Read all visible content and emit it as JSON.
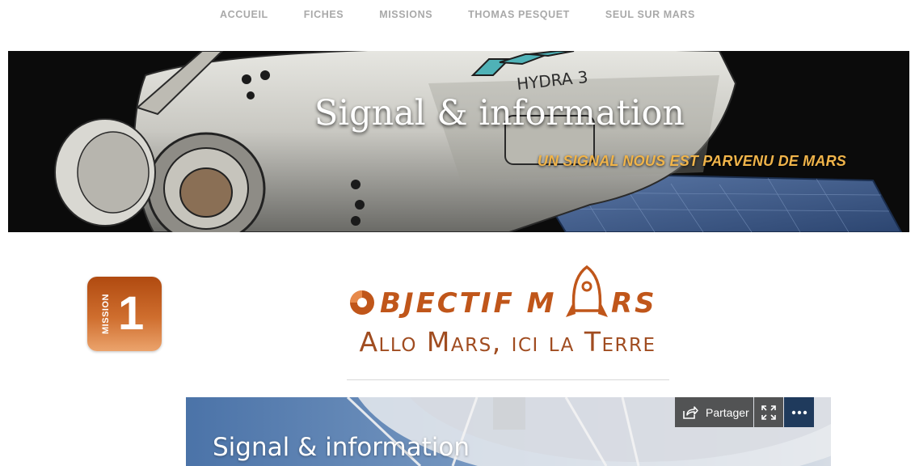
{
  "nav": {
    "items": [
      "ACCUEIL",
      "FICHES",
      "MISSIONS",
      "THOMAS PESQUET",
      "SEUL SUR MARS"
    ]
  },
  "hero": {
    "title": "Signal & information",
    "subtitle": "UN SIGNAL NOUS EST PARVENU DE MARS",
    "ship_label": "HYDRA 3"
  },
  "badge": {
    "word": "MISSION",
    "number": "1"
  },
  "logo": {
    "title": "OBJECTIF MARS",
    "subtitle": "Allo Mars, ici la Terre"
  },
  "embed": {
    "title": "Signal & information",
    "share_label": "Partager",
    "share_icon": "share-icon",
    "fullscreen_icon": "fullscreen-icon",
    "more_icon": "more-icon"
  },
  "colors": {
    "accent_orange": "#c0561a",
    "subtitle_gold": "#f0b44a",
    "nav_gray": "#a9a9a9"
  }
}
